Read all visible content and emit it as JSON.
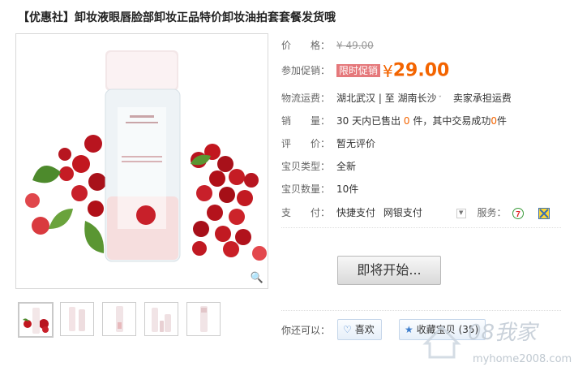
{
  "title": "【优惠社】卸妆液眼唇脸部卸妆正品特价卸妆油拍套套餐发货哦",
  "props": {
    "price_label": "价　　格：",
    "price_old": "¥ 49.00",
    "promo_label": "参加促销：",
    "promo_tag": "限时促销",
    "currency": "¥",
    "promo_price": "29.00",
    "shipping_label": "物流运费：",
    "ship_from": "湖北武汉",
    "ship_sep": "| 至",
    "ship_to": "湖南长沙",
    "ship_note": "卖家承担运费",
    "sales_label": "销　　量：",
    "sales_prefix": "30 天内已售出",
    "sales_count": "0",
    "sales_mid": "件，其中交易成功",
    "sales_success": "0",
    "sales_suffix": "件",
    "rating_label": "评　　价：",
    "rating_value": "暂无评价",
    "type_label": "宝贝类型：",
    "type_value": "全新",
    "qty_label": "宝贝数量：",
    "qty_value": "10件",
    "pay_label": "支　　付：",
    "pay_quick": "快捷支付",
    "pay_bank": "网银支付",
    "service_label": "服务："
  },
  "cta_label": "即将开始...",
  "also_label": "你还可以：",
  "like_label": "喜欢",
  "fav_label": "收藏宝贝 (35)",
  "watermark": {
    "brand": "08我家",
    "url": "myhome2008.com"
  },
  "icons": {
    "zoom": "magnifier-icon",
    "like": "heart-icon",
    "fav": "star-icon"
  },
  "colors": {
    "accent": "#f36400",
    "promo_tag_bg": "#e5787b"
  }
}
